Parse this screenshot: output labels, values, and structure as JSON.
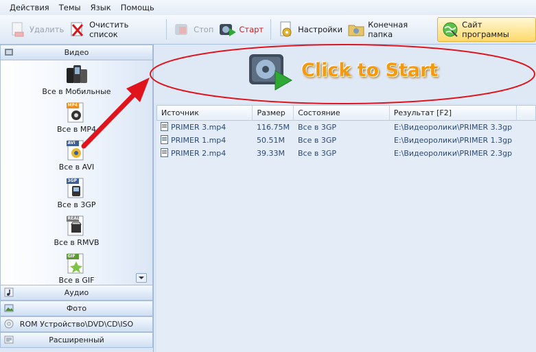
{
  "menu": [
    "Действия",
    "Темы",
    "Язык",
    "Помощь"
  ],
  "toolbar": {
    "delete": "Удалить",
    "clear_list": "Очистить список",
    "stop": "Стоп",
    "start": "Старт",
    "settings": "Настройки",
    "output_folder": "Конечная папка",
    "website": "Сайт программы"
  },
  "left_pane": {
    "video_header": "Видео",
    "formats": [
      {
        "label": "Все в Мобильные",
        "icon": "mobile-phones-icon"
      },
      {
        "label": "Все в MP4",
        "icon": "mp4-icon",
        "badge": "MP4"
      },
      {
        "label": "Все в AVI",
        "icon": "avi-icon",
        "badge": "AVI"
      },
      {
        "label": "Все в 3GP",
        "icon": "3gp-icon",
        "badge": "3GP"
      },
      {
        "label": "Все в RMVB",
        "icon": "rmvb-icon",
        "badge": "REAL"
      },
      {
        "label": "Все в GIF",
        "icon": "gif-icon",
        "badge": "GIF"
      }
    ],
    "audio_header": "Аудио",
    "photo_header": "Фото",
    "rom_header": "ROM Устройство\\DVD\\CD\\ISO",
    "advanced_header": "Расширенный"
  },
  "banner": {
    "text": "Click to Start"
  },
  "table": {
    "columns": [
      "Источник",
      "Размер",
      "Состояние",
      "Результат [F2]"
    ],
    "rows": [
      {
        "source": "PRIMER 3.mp4",
        "size": "116.75M",
        "status": "Все в 3GP",
        "result": "E:\\Видеоролики\\PRIMER 3.3gp"
      },
      {
        "source": "PRIMER 1.mp4",
        "size": "50.51M",
        "status": "Все в 3GP",
        "result": "E:\\Видеоролики\\PRIMER 1.3gp"
      },
      {
        "source": "PRIMER 2.mp4",
        "size": "39.33M",
        "status": "Все в 3GP",
        "result": "E:\\Видеоролики\\PRIMER 2.3gp"
      }
    ]
  },
  "colors": {
    "annotation_red": "#e0141c",
    "banner_orange": "#f39a12",
    "start_red": "#cc1f1f",
    "highlight_button": "#ffd96b"
  }
}
